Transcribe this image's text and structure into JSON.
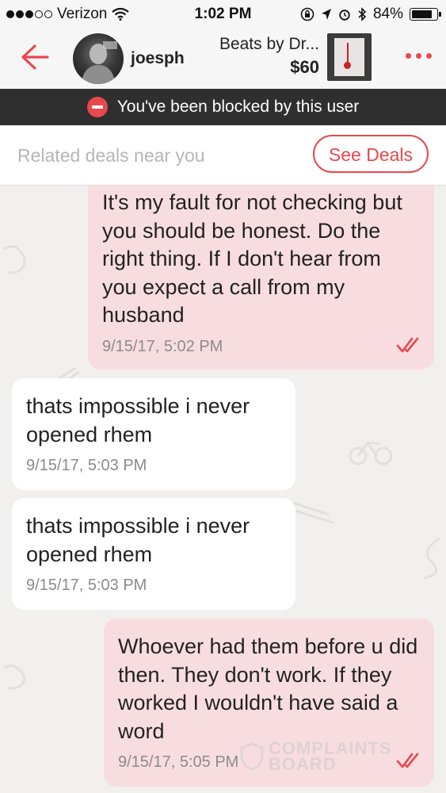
{
  "status_bar": {
    "carrier": "Verizon",
    "time": "1:02 PM",
    "battery": "84%",
    "battery_fraction": 0.84
  },
  "header": {
    "username": "joesph",
    "listing_title": "Beats by Dr...",
    "listing_price": "$60"
  },
  "banner": {
    "text": "You've been blocked by this user"
  },
  "deals": {
    "placeholder": "Related deals near you",
    "button": "See Deals"
  },
  "messages": [
    {
      "direction": "sent",
      "text": "It's my fault for not checking but you should be honest. Do the right thing. If I don't hear from you expect a call from my husband",
      "time": "9/15/17, 5:02 PM"
    },
    {
      "direction": "received",
      "text": "thats impossible i never opened rhem",
      "time": "9/15/17, 5:03 PM"
    },
    {
      "direction": "received",
      "text": "thats impossible i never opened rhem",
      "time": "9/15/17, 5:03 PM"
    },
    {
      "direction": "sent",
      "text": "Whoever had them before u did then. They don't work. If they worked I wouldn't have said a word",
      "time": "9/15/17, 5:05 PM"
    }
  ],
  "watermark": {
    "line1": "COMPLAINTS",
    "line2": "BOARD"
  },
  "colors": {
    "accent": "#e8484e",
    "sent_bubble": "#f8dde0",
    "received_bubble": "#ffffff",
    "banner": "#2f2f2f"
  }
}
